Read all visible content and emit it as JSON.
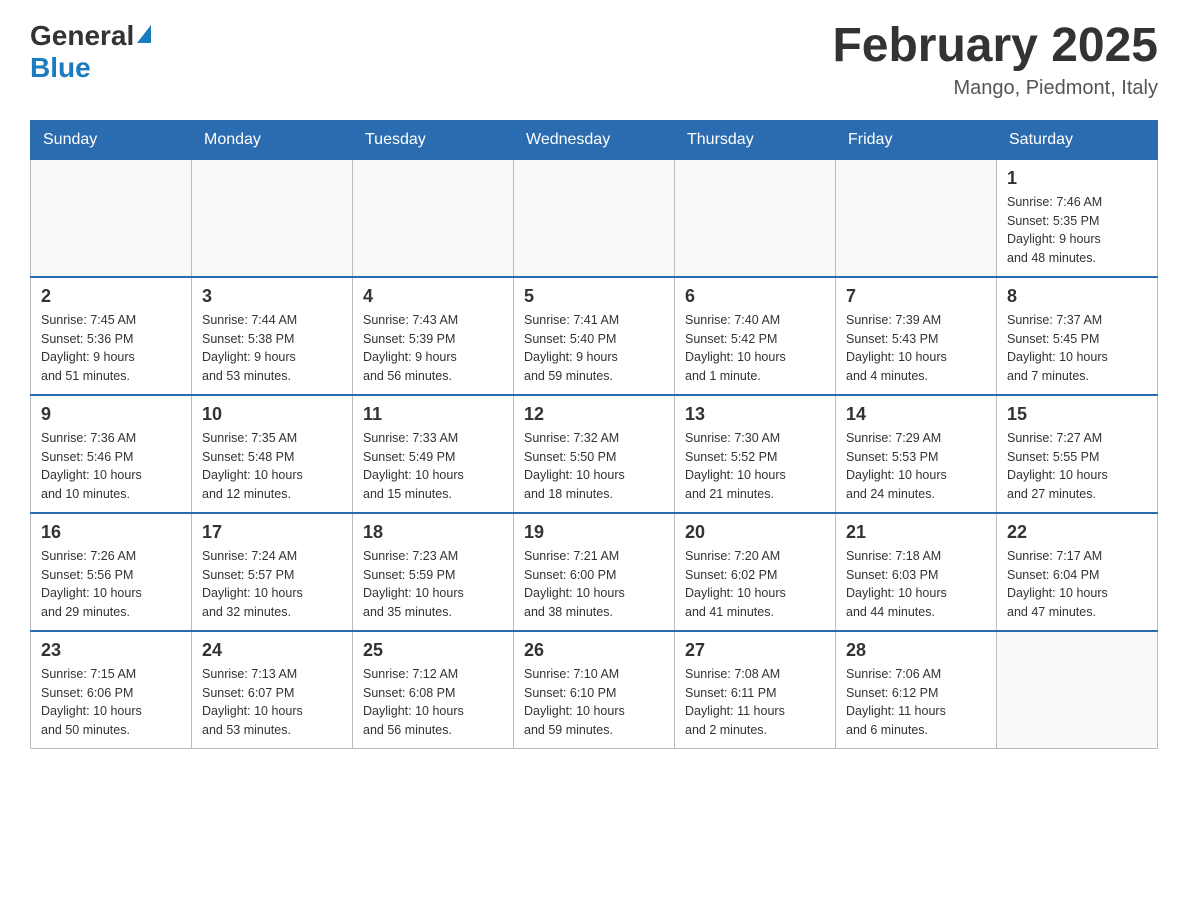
{
  "header": {
    "logo_general": "General",
    "logo_blue": "Blue",
    "month_title": "February 2025",
    "location": "Mango, Piedmont, Italy"
  },
  "weekdays": [
    "Sunday",
    "Monday",
    "Tuesday",
    "Wednesday",
    "Thursday",
    "Friday",
    "Saturday"
  ],
  "weeks": [
    [
      {
        "day": "",
        "info": ""
      },
      {
        "day": "",
        "info": ""
      },
      {
        "day": "",
        "info": ""
      },
      {
        "day": "",
        "info": ""
      },
      {
        "day": "",
        "info": ""
      },
      {
        "day": "",
        "info": ""
      },
      {
        "day": "1",
        "info": "Sunrise: 7:46 AM\nSunset: 5:35 PM\nDaylight: 9 hours\nand 48 minutes."
      }
    ],
    [
      {
        "day": "2",
        "info": "Sunrise: 7:45 AM\nSunset: 5:36 PM\nDaylight: 9 hours\nand 51 minutes."
      },
      {
        "day": "3",
        "info": "Sunrise: 7:44 AM\nSunset: 5:38 PM\nDaylight: 9 hours\nand 53 minutes."
      },
      {
        "day": "4",
        "info": "Sunrise: 7:43 AM\nSunset: 5:39 PM\nDaylight: 9 hours\nand 56 minutes."
      },
      {
        "day": "5",
        "info": "Sunrise: 7:41 AM\nSunset: 5:40 PM\nDaylight: 9 hours\nand 59 minutes."
      },
      {
        "day": "6",
        "info": "Sunrise: 7:40 AM\nSunset: 5:42 PM\nDaylight: 10 hours\nand 1 minute."
      },
      {
        "day": "7",
        "info": "Sunrise: 7:39 AM\nSunset: 5:43 PM\nDaylight: 10 hours\nand 4 minutes."
      },
      {
        "day": "8",
        "info": "Sunrise: 7:37 AM\nSunset: 5:45 PM\nDaylight: 10 hours\nand 7 minutes."
      }
    ],
    [
      {
        "day": "9",
        "info": "Sunrise: 7:36 AM\nSunset: 5:46 PM\nDaylight: 10 hours\nand 10 minutes."
      },
      {
        "day": "10",
        "info": "Sunrise: 7:35 AM\nSunset: 5:48 PM\nDaylight: 10 hours\nand 12 minutes."
      },
      {
        "day": "11",
        "info": "Sunrise: 7:33 AM\nSunset: 5:49 PM\nDaylight: 10 hours\nand 15 minutes."
      },
      {
        "day": "12",
        "info": "Sunrise: 7:32 AM\nSunset: 5:50 PM\nDaylight: 10 hours\nand 18 minutes."
      },
      {
        "day": "13",
        "info": "Sunrise: 7:30 AM\nSunset: 5:52 PM\nDaylight: 10 hours\nand 21 minutes."
      },
      {
        "day": "14",
        "info": "Sunrise: 7:29 AM\nSunset: 5:53 PM\nDaylight: 10 hours\nand 24 minutes."
      },
      {
        "day": "15",
        "info": "Sunrise: 7:27 AM\nSunset: 5:55 PM\nDaylight: 10 hours\nand 27 minutes."
      }
    ],
    [
      {
        "day": "16",
        "info": "Sunrise: 7:26 AM\nSunset: 5:56 PM\nDaylight: 10 hours\nand 29 minutes."
      },
      {
        "day": "17",
        "info": "Sunrise: 7:24 AM\nSunset: 5:57 PM\nDaylight: 10 hours\nand 32 minutes."
      },
      {
        "day": "18",
        "info": "Sunrise: 7:23 AM\nSunset: 5:59 PM\nDaylight: 10 hours\nand 35 minutes."
      },
      {
        "day": "19",
        "info": "Sunrise: 7:21 AM\nSunset: 6:00 PM\nDaylight: 10 hours\nand 38 minutes."
      },
      {
        "day": "20",
        "info": "Sunrise: 7:20 AM\nSunset: 6:02 PM\nDaylight: 10 hours\nand 41 minutes."
      },
      {
        "day": "21",
        "info": "Sunrise: 7:18 AM\nSunset: 6:03 PM\nDaylight: 10 hours\nand 44 minutes."
      },
      {
        "day": "22",
        "info": "Sunrise: 7:17 AM\nSunset: 6:04 PM\nDaylight: 10 hours\nand 47 minutes."
      }
    ],
    [
      {
        "day": "23",
        "info": "Sunrise: 7:15 AM\nSunset: 6:06 PM\nDaylight: 10 hours\nand 50 minutes."
      },
      {
        "day": "24",
        "info": "Sunrise: 7:13 AM\nSunset: 6:07 PM\nDaylight: 10 hours\nand 53 minutes."
      },
      {
        "day": "25",
        "info": "Sunrise: 7:12 AM\nSunset: 6:08 PM\nDaylight: 10 hours\nand 56 minutes."
      },
      {
        "day": "26",
        "info": "Sunrise: 7:10 AM\nSunset: 6:10 PM\nDaylight: 10 hours\nand 59 minutes."
      },
      {
        "day": "27",
        "info": "Sunrise: 7:08 AM\nSunset: 6:11 PM\nDaylight: 11 hours\nand 2 minutes."
      },
      {
        "day": "28",
        "info": "Sunrise: 7:06 AM\nSunset: 6:12 PM\nDaylight: 11 hours\nand 6 minutes."
      },
      {
        "day": "",
        "info": ""
      }
    ]
  ]
}
